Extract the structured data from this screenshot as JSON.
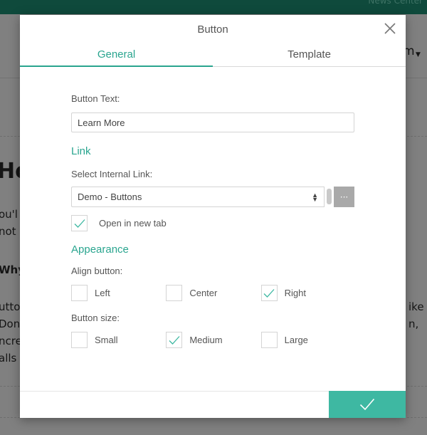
{
  "background": {
    "news_link": "News Center",
    "heading_fragment": "Ho",
    "nav_fragment": "m",
    "para_left_1": "ou'l",
    "para_left_2": "not",
    "bold_left": "Why",
    "para_left_3": "utto",
    "para_left_4": "Don",
    "para_left_5": "ncre",
    "para_left_6": "alls",
    "para_right_1": "ike",
    "para_right_2": "n,"
  },
  "modal": {
    "title": "Button",
    "close_icon": "close-icon",
    "tabs": [
      {
        "label": "General",
        "active": true
      },
      {
        "label": "Template",
        "active": false
      }
    ],
    "general": {
      "button_text_label": "Button Text:",
      "button_text_value": "Learn More",
      "link_section": "Link",
      "internal_link_label": "Select Internal Link:",
      "internal_link_value": "Demo - Buttons",
      "more_button_label": "···",
      "open_new_tab_label": "Open in new tab",
      "open_new_tab_checked": true,
      "appearance_section": "Appearance",
      "align_label": "Align button:",
      "align_options": [
        {
          "label": "Left",
          "checked": false
        },
        {
          "label": "Center",
          "checked": false
        },
        {
          "label": "Right",
          "checked": true
        }
      ],
      "size_label": "Button size:",
      "size_options": [
        {
          "label": "Small",
          "checked": false
        },
        {
          "label": "Medium",
          "checked": true
        },
        {
          "label": "Large",
          "checked": false
        }
      ]
    },
    "footer": {
      "confirm_icon": "checkmark-icon"
    }
  },
  "colors": {
    "accent": "#2aa58f",
    "confirm_button": "#3eb8a2",
    "topbar": "#0f4a3c",
    "overlay": "#808080"
  }
}
